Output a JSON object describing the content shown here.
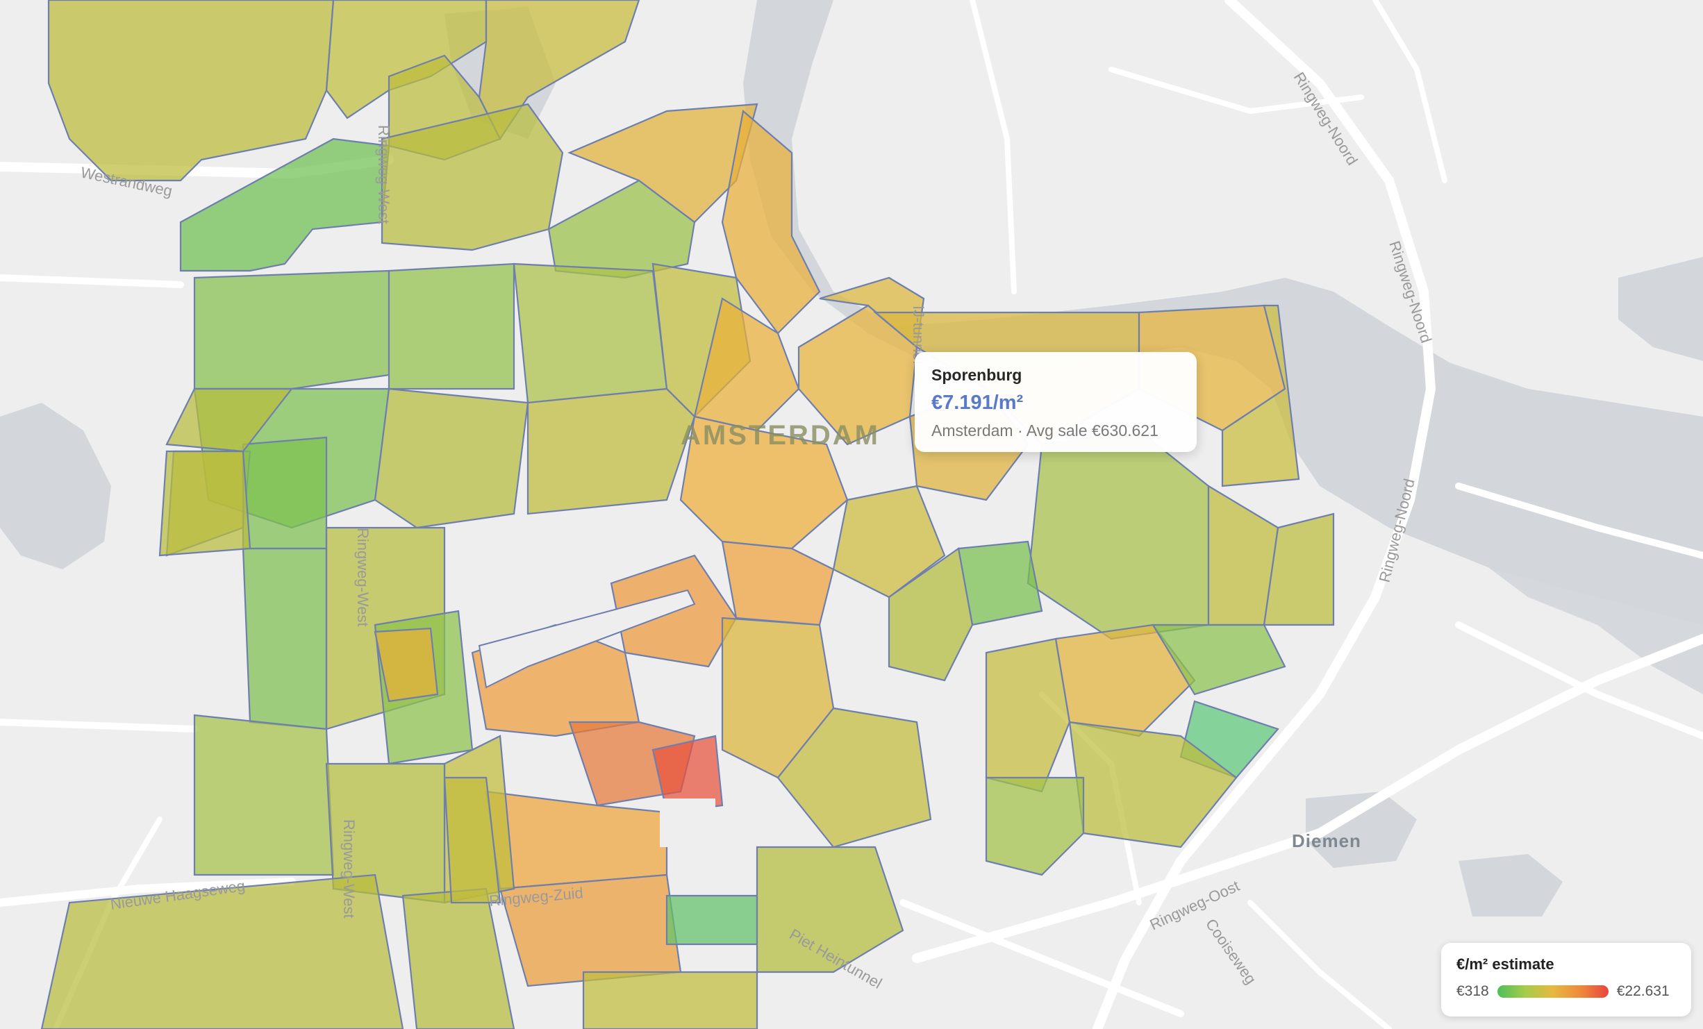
{
  "map": {
    "city_label": "AMSTERDAM",
    "town_label": "Diemen",
    "road_labels": [
      "Westrandweg",
      "Ringweg-West",
      "Ringweg-Noord",
      "Ringweg-Oost",
      "Ringweg-Zuid",
      "Cooiseweg",
      "Nieuwe Haagseweg",
      "IJ-tunnel",
      "Piet Heintunnel"
    ]
  },
  "tooltip": {
    "neighborhood": "Sporenburg",
    "price_per_m2": "€7.191/m²",
    "detail": "Amsterdam · Avg sale €630.621"
  },
  "legend": {
    "title": "€/m² estimate",
    "min_label": "€318",
    "max_label": "€22.631",
    "min_value": 318,
    "max_value": 22631,
    "gradient_colors": [
      "#4cbf5a",
      "#a6cc4a",
      "#e6b840",
      "#ee8a3a",
      "#e8443f"
    ]
  },
  "colors": {
    "water": "#d3d6da",
    "land": "#eeeeee",
    "road": "#ffffff",
    "tooltip_price": "#5577cc",
    "boundary": "#6e7fae"
  }
}
